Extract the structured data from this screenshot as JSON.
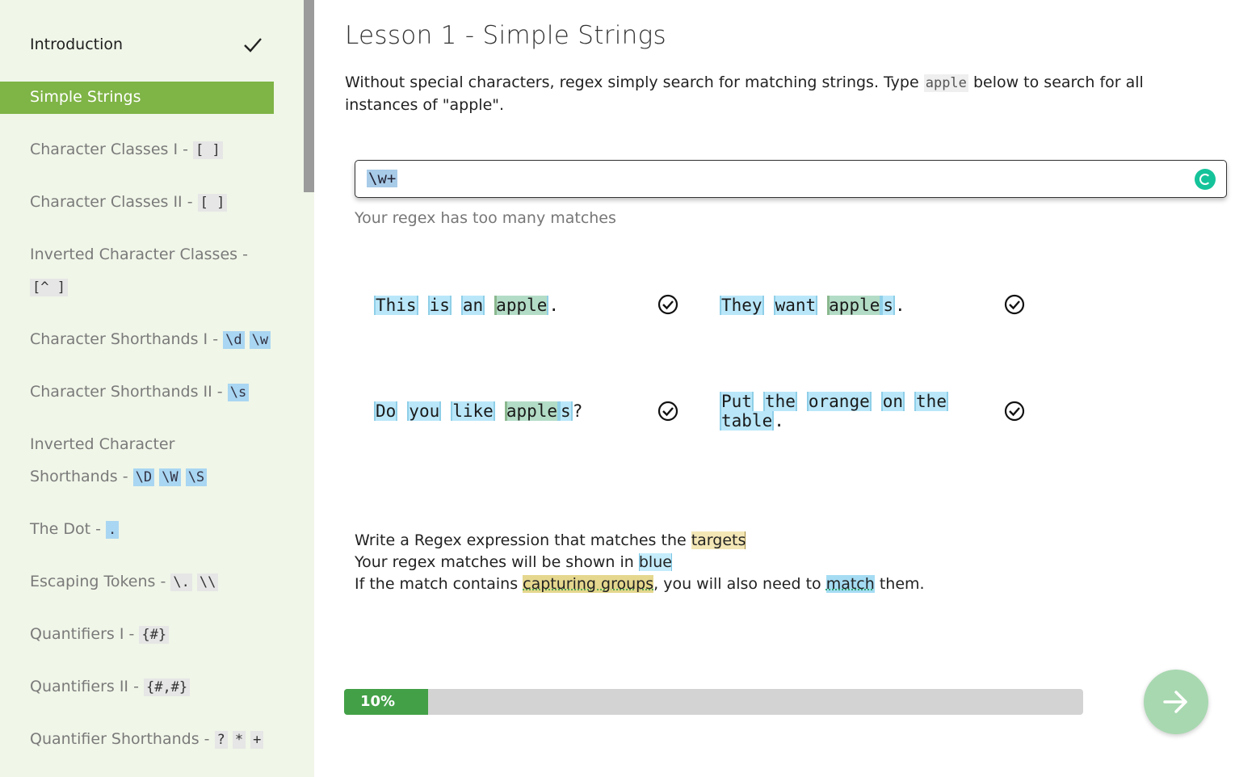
{
  "lesson": {
    "title": "Lesson 1 - Simple Strings",
    "description_before": "Without special characters, regex simply search for matching strings. Type ",
    "description_code": "apple",
    "description_after": " below to search for all instances of \"apple\"."
  },
  "regex_input": {
    "value": "\\w+"
  },
  "status_text": "Your regex has too many matches",
  "sidebar": {
    "items": [
      {
        "label": "Introduction",
        "tokens": [],
        "completed": true
      },
      {
        "label": "Simple Strings",
        "tokens": [],
        "active": true
      },
      {
        "label": "Character Classes I - ",
        "tokens": [
          "[ ]"
        ]
      },
      {
        "label": "Character Classes II - ",
        "tokens": [
          "[ ]"
        ]
      },
      {
        "label": "Inverted Character Classes -",
        "label2": "",
        "tokens": [
          "[^ ]"
        ]
      },
      {
        "label": "Character Shorthands I - ",
        "tokens": [
          "\\d",
          "\\w"
        ]
      },
      {
        "label": "Character Shorthands II - ",
        "tokens": [
          "\\s"
        ]
      },
      {
        "label": "Inverted Character",
        "label2": "Shorthands - ",
        "tokens": [
          "\\D",
          "\\W",
          "\\S"
        ]
      },
      {
        "label": "The Dot - ",
        "tokens": [
          "."
        ]
      },
      {
        "label": "Escaping Tokens - ",
        "tokens": [
          "\\.",
          "\\\\"
        ]
      },
      {
        "label": "Quantifiers I - ",
        "tokens": [
          "{#}"
        ]
      },
      {
        "label": "Quantifiers II - ",
        "tokens": [
          "{#,#}"
        ]
      },
      {
        "label": "Quantifier Shorthands - ",
        "tokens": [
          "?",
          "*",
          "+"
        ]
      }
    ]
  },
  "examples": [
    {
      "words": [
        "This",
        "is",
        "an",
        "apple"
      ],
      "suffix": ".",
      "passed": true
    },
    {
      "words": [
        "They",
        "want",
        "apple"
      ],
      "extra": "s",
      "suffix": ".",
      "passed": true
    },
    {
      "words": [
        "Do",
        "you",
        "like",
        "apple"
      ],
      "extra": "s",
      "suffix": "?",
      "passed": true
    },
    {
      "words": [
        "Put",
        "the",
        "orange",
        "on",
        "the"
      ],
      "words2": [
        "table"
      ],
      "suffix": ".",
      "passed": true
    }
  ],
  "legend": {
    "line1_before": "Write a Regex expression that matches the ",
    "line1_targets": "targets",
    "line2_before": "Your regex matches will be shown in ",
    "line2_blue": "blue",
    "line3_before": "If the match contains ",
    "line3_capturing": "capturing groups",
    "line3_middle": ", you will also need to ",
    "line3_match": "match",
    "line3_after": " them."
  },
  "progress": {
    "percent": 10,
    "label": "10%"
  },
  "icons": {
    "check": "checkmark-icon",
    "pass": "check-circle-icon",
    "next": "arrow-right-icon",
    "grammarly": "grammarly-icon"
  },
  "colors": {
    "accent": "#7fb446",
    "progress": "#43a047",
    "match_blue": "#b9e7f9",
    "target": "#f4e7b6"
  }
}
